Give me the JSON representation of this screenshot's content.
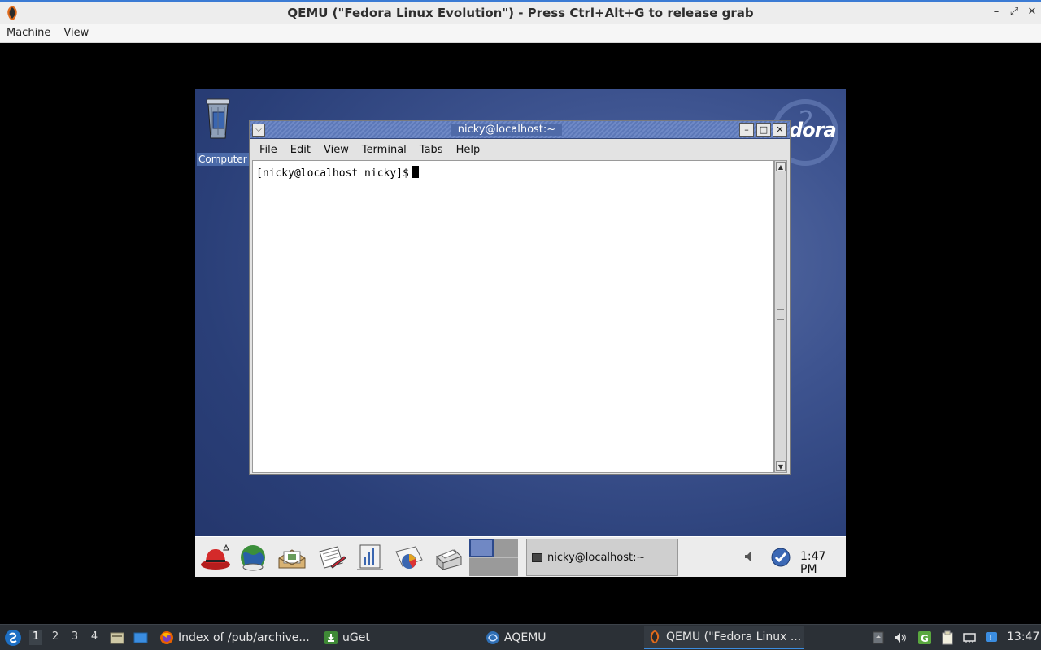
{
  "host_window": {
    "title": "QEMU (\"Fedora Linux Evolution\") - Press Ctrl+Alt+G to release grab",
    "menus": [
      "Machine",
      "View"
    ],
    "controls": [
      "–",
      "⤢",
      "✕"
    ]
  },
  "vm": {
    "desktop": {
      "computer_icon_label": "Computer ic",
      "fedora_logo_text": "dora"
    },
    "terminal": {
      "title": "nicky@localhost:~",
      "menus": [
        {
          "prefix": "",
          "mnemonic": "F",
          "rest": "ile"
        },
        {
          "prefix": "",
          "mnemonic": "E",
          "rest": "dit"
        },
        {
          "prefix": "",
          "mnemonic": "V",
          "rest": "iew"
        },
        {
          "prefix": "",
          "mnemonic": "T",
          "rest": "erminal"
        },
        {
          "prefix": "Ta",
          "mnemonic": "b",
          "rest": "s"
        },
        {
          "prefix": "",
          "mnemonic": "H",
          "rest": "elp"
        }
      ],
      "prompt": "[nicky@localhost nicky]$"
    },
    "panel": {
      "launchers": [
        "redhat-menu-icon",
        "web-browser-icon",
        "email-icon",
        "writer-icon",
        "presentation-icon",
        "spreadsheet-icon",
        "print-manager-icon"
      ],
      "task_label": "nicky@localhost:~",
      "clock": "1:47 PM"
    }
  },
  "host_taskbar": {
    "workspaces": [
      "1",
      "2",
      "3",
      "4"
    ],
    "active_workspace": "1",
    "tasks": [
      {
        "label": "Index of /pub/archive...",
        "icon": "firefox-icon"
      },
      {
        "label": "uGet",
        "icon": "uget-icon"
      },
      {
        "label": "AQEMU",
        "icon": "aqemu-icon"
      },
      {
        "label": "QEMU (\"Fedora Linux ...",
        "icon": "qemu-icon"
      }
    ],
    "clock": "13:47"
  },
  "colors": {
    "accent": "#3b8de0",
    "terminal_titlebar": "#5c78b8",
    "desktop_bg": "#2a3f78"
  }
}
